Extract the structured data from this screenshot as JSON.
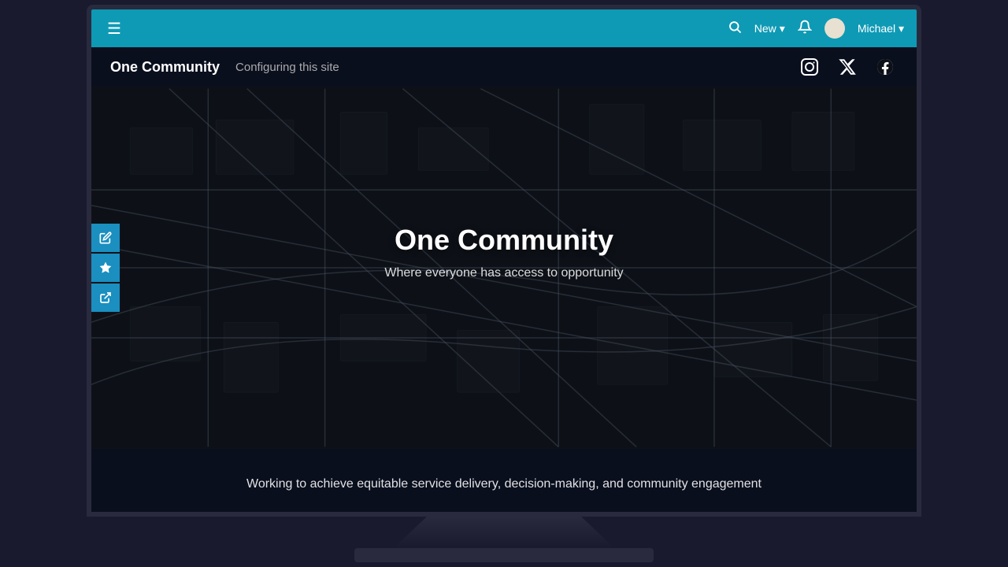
{
  "topNav": {
    "new_label": "New",
    "user_name": "Michael",
    "dropdown_arrow": "▾",
    "hamburger": "☰"
  },
  "subNav": {
    "site_title": "One Community",
    "configuring_text": "Configuring this site",
    "social_icons": [
      {
        "name": "instagram",
        "symbol": "ⓘ"
      },
      {
        "name": "twitter",
        "symbol": "𝕏"
      },
      {
        "name": "facebook",
        "symbol": "f"
      }
    ]
  },
  "hero": {
    "title": "One Community",
    "subtitle": "Where everyone has access to opportunity"
  },
  "sideToolbar": {
    "tools": [
      {
        "name": "edit",
        "icon": "✏"
      },
      {
        "name": "favorite",
        "icon": "★"
      },
      {
        "name": "share",
        "icon": "⬡"
      }
    ]
  },
  "bottomSection": {
    "description": "Working to achieve equitable service delivery, decision-making, and community engagement"
  }
}
